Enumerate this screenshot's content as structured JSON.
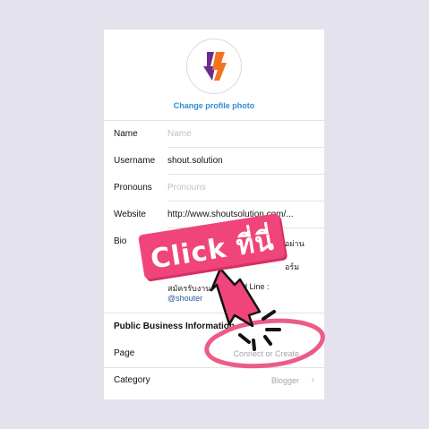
{
  "profile": {
    "change_photo_label": "Change profile photo",
    "avatar_icon": "shout-solution-logo",
    "colors": {
      "logo_orange": "#f4731f",
      "logo_purple": "#6a2c91",
      "link": "#2b8fd6"
    }
  },
  "fields": {
    "name": {
      "label": "Name",
      "placeholder": "Name"
    },
    "username": {
      "label": "Username",
      "value": "shout.solution"
    },
    "pronouns": {
      "label": "Pronouns",
      "placeholder": "Pronouns"
    },
    "website": {
      "label": "Website",
      "value": "http://www.shoutsolution.com/..."
    },
    "bio": {
      "label": "Bio",
      "line1_end": "ต่อผ่าน",
      "line2_end": "อร์ม",
      "line3": "สมัครรับงาน",
      "line3_end": "dd Line :",
      "line4": "@shouter"
    }
  },
  "business": {
    "section_title": "Public Business Information",
    "page": {
      "label": "Page",
      "value": "Connect or Create"
    },
    "category": {
      "label": "Category",
      "value": "Blogger"
    }
  },
  "callout": {
    "text": "Click ที่นี่",
    "colors": {
      "banner": "#f0457a",
      "ring": "#ec5c86",
      "arrow": "#111111"
    }
  }
}
